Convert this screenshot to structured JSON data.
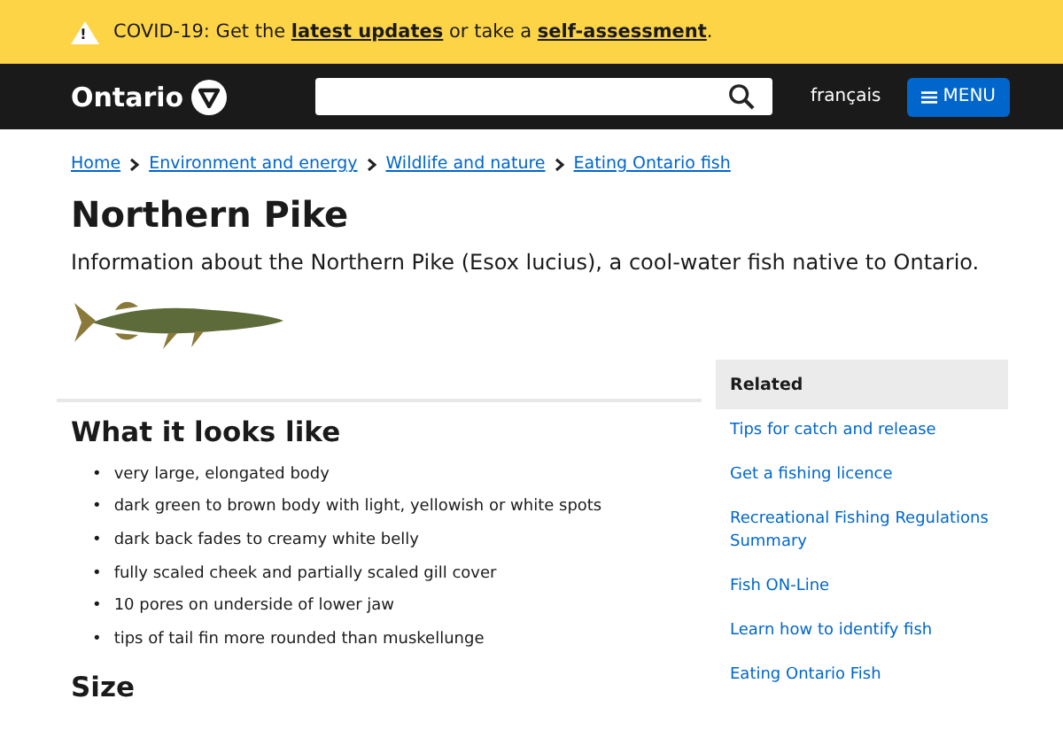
{
  "alert": {
    "icon": "!",
    "before": "COVID-19: Get the ",
    "link1": "latest updates",
    "middle": " or take a ",
    "link2": "self-assessment",
    "after": "."
  },
  "header": {
    "logo": "Ontario",
    "language": "français",
    "menu": "MENU"
  },
  "breadcrumb": [
    "Home",
    "Environment and energy",
    "Wildlife and nature",
    "Eating Ontario fish"
  ],
  "title": "Northern Pike",
  "intro": "Information about the Northern Pike (Esox lucius), a cool-water fish native to Ontario.",
  "sections": [
    {
      "heading": "What it looks like",
      "items": [
        {
          "bullet": "•",
          "text": "very large, elongated body"
        },
        {
          "bullet": "•",
          "text": "dark green to brown body with light, yellowish or white spots"
        },
        {
          "bullet": "•",
          "text": "dark back fades to creamy white belly"
        },
        {
          "bullet": "•",
          "text": "fully scaled cheek and partially scaled gill cover"
        },
        {
          "bullet": "•",
          "text": "10 pores on underside of lower jaw"
        },
        {
          "bullet": "•",
          "text": "tips of tail fin more rounded than muskellunge"
        }
      ]
    },
    {
      "heading": "Size"
    }
  ],
  "related": {
    "heading": "Related",
    "links": [
      "Tips for catch and release",
      "Get a fishing licence",
      "Recreational Fishing Regulations Summary",
      "Fish ON-Line",
      "Learn how to identify fish",
      "Eating Ontario Fish"
    ]
  }
}
